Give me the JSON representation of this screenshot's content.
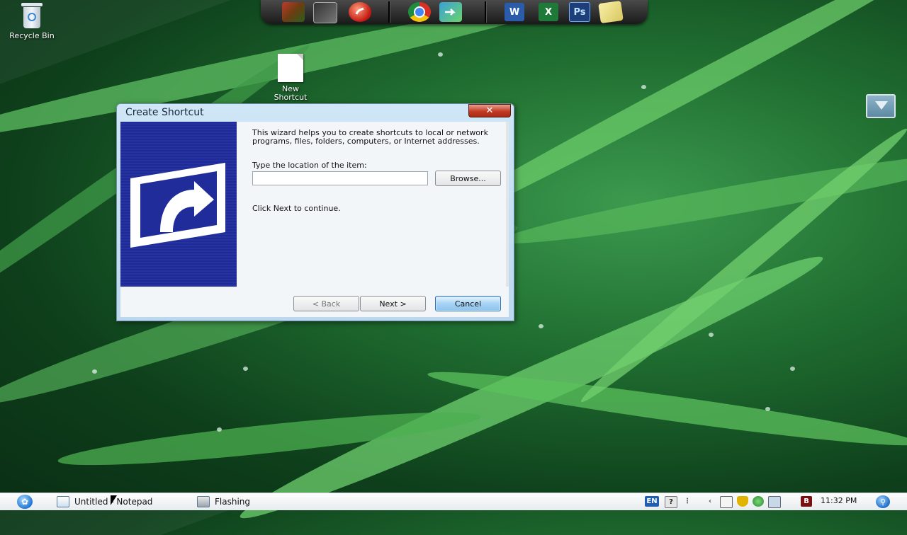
{
  "desktop": {
    "icons": [
      {
        "label": "Recycle Bin",
        "icon": "recycle-bin-icon"
      },
      {
        "label": "New Shortcut",
        "icon": "blank-file-icon"
      }
    ]
  },
  "dock": {
    "items": [
      {
        "icon": "media-gallery-icon"
      },
      {
        "icon": "games-icon"
      },
      {
        "icon": "flash-icon"
      },
      {
        "icon": "chrome-icon"
      },
      {
        "icon": "transfer-icon"
      },
      {
        "icon": "word-icon",
        "text": "W",
        "color": "#2a5caa"
      },
      {
        "icon": "excel-icon",
        "text": "X",
        "color": "#1f7a3a"
      },
      {
        "icon": "photoshop-icon",
        "text": "Ps",
        "color": "#1d3e79"
      },
      {
        "icon": "sticky-notes-icon"
      }
    ]
  },
  "dialog": {
    "title": "Create Shortcut",
    "close_label": "✕",
    "intro": "This wizard helps you to create shortcuts to local or network programs, files, folders, computers, or Internet addresses.",
    "location_label": "Type the location of the item:",
    "location_value": "",
    "browse_label": "Browse...",
    "continue_text": "Click Next to continue.",
    "back_label": "< Back",
    "next_label": "Next >",
    "cancel_label": "Cancel",
    "back_enabled": false
  },
  "taskbar": {
    "tasks": [
      {
        "label": "Untitled - Notepad",
        "icon": "notepad-icon"
      },
      {
        "label": "Flashing",
        "icon": "window-icon"
      }
    ],
    "tray": {
      "language": "EN",
      "clock": "11:32 PM"
    }
  },
  "colors": {
    "banner": "#1d2a97",
    "default_button": "#8ec3ee",
    "close_button": "#c23a22"
  }
}
